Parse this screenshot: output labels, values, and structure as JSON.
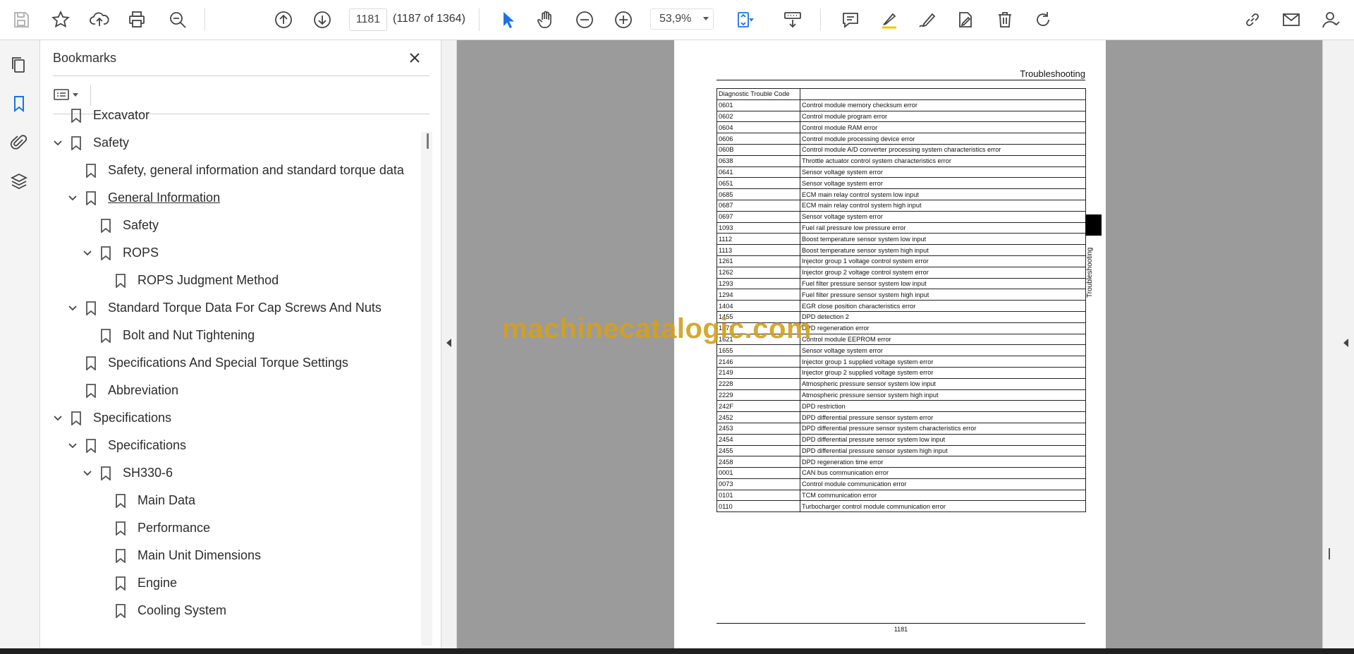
{
  "toolbar": {
    "page_current": "1181",
    "page_count": "(1187 of 1364)",
    "zoom": "53,9%",
    "icons": [
      "save-icon",
      "star-icon",
      "upload-icon",
      "print-icon",
      "zoom-search-icon",
      "prev-page-icon",
      "next-page-icon",
      "select-cursor-icon",
      "hand-icon",
      "zoom-out-icon",
      "zoom-in-icon",
      "fit-page-icon",
      "scroll-mode-icon",
      "comment-icon",
      "highlight-icon",
      "draw-icon",
      "fill-sign-icon",
      "delete-icon",
      "rotate-icon",
      "share-link-icon",
      "mail-icon",
      "account-icon"
    ]
  },
  "panel": {
    "title": "Bookmarks",
    "bookmarks": [
      {
        "label": "Excavator",
        "level": 0,
        "expanded": null,
        "underline": false
      },
      {
        "label": "Safety",
        "level": 0,
        "expanded": true,
        "underline": false
      },
      {
        "label": "Safety, general information and standard torque data",
        "level": 1,
        "expanded": null,
        "underline": false
      },
      {
        "label": "General Information",
        "level": 1,
        "expanded": true,
        "underline": true
      },
      {
        "label": "Safety",
        "level": 2,
        "expanded": null,
        "underline": false
      },
      {
        "label": "ROPS",
        "level": 2,
        "expanded": true,
        "underline": false
      },
      {
        "label": "ROPS Judgment Method",
        "level": 3,
        "expanded": null,
        "underline": false
      },
      {
        "label": "Standard Torque Data For Cap Screws And Nuts",
        "level": 1,
        "expanded": true,
        "underline": false
      },
      {
        "label": "Bolt and Nut Tightening",
        "level": 2,
        "expanded": null,
        "underline": false
      },
      {
        "label": "Specifications And Special Torque Settings",
        "level": 1,
        "expanded": null,
        "underline": false
      },
      {
        "label": "Abbreviation",
        "level": 1,
        "expanded": null,
        "underline": false
      },
      {
        "label": "Specifications",
        "level": 0,
        "expanded": true,
        "underline": false
      },
      {
        "label": "Specifications",
        "level": 1,
        "expanded": true,
        "underline": false
      },
      {
        "label": "SH330-6",
        "level": 2,
        "expanded": true,
        "underline": false
      },
      {
        "label": "Main Data",
        "level": 3,
        "expanded": null,
        "underline": false
      },
      {
        "label": "Performance",
        "level": 3,
        "expanded": null,
        "underline": false
      },
      {
        "label": "Main Unit Dimensions",
        "level": 3,
        "expanded": null,
        "underline": false
      },
      {
        "label": "Engine",
        "level": 3,
        "expanded": null,
        "underline": false
      },
      {
        "label": "Cooling System",
        "level": 3,
        "expanded": null,
        "underline": false
      }
    ]
  },
  "document": {
    "header": "Troubleshooting",
    "side_tab": "Troubleshooting",
    "table_header": [
      "Diagnostic Trouble Code",
      ""
    ],
    "rows": [
      [
        "0601",
        "Control module memory checksum error"
      ],
      [
        "0602",
        "Control module program error"
      ],
      [
        "0604",
        "Control module RAM error"
      ],
      [
        "0606",
        "Control module processing device error"
      ],
      [
        "060B",
        "Control module A/D converter processing system characteristics error"
      ],
      [
        "0638",
        "Throttle actuator control system characteristics error"
      ],
      [
        "0641",
        "Sensor voltage system error"
      ],
      [
        "0651",
        "Sensor voltage system error"
      ],
      [
        "0685",
        "ECM main relay control system low input"
      ],
      [
        "0687",
        "ECM main relay control system high input"
      ],
      [
        "0697",
        "Sensor voltage system error"
      ],
      [
        "1093",
        "Fuel rail pressure low pressure error"
      ],
      [
        "1112",
        "Boost temperature sensor system low input"
      ],
      [
        "1113",
        "Boost temperature sensor system high input"
      ],
      [
        "1261",
        "Injector group 1 voltage control system error"
      ],
      [
        "1262",
        "Injector group 2 voltage control system error"
      ],
      [
        "1293",
        "Fuel filter pressure sensor system low input"
      ],
      [
        "1294",
        "Fuel filter pressure sensor system high input"
      ],
      [
        "1404",
        "EGR close position characteristics error"
      ],
      [
        "1455",
        "DPD detection 2"
      ],
      [
        "1471",
        "DPD regeneration error"
      ],
      [
        "1621",
        "Control module EEPROM error"
      ],
      [
        "1655",
        "Sensor voltage system error"
      ],
      [
        "2146",
        "Injector group 1 supplied voltage system error"
      ],
      [
        "2149",
        "Injector group 2 supplied voltage system error"
      ],
      [
        "2228",
        "Atmospheric pressure sensor system low input"
      ],
      [
        "2229",
        "Atmospheric pressure sensor system high input"
      ],
      [
        "242F",
        "DPD restriction"
      ],
      [
        "2452",
        "DPD differential pressure sensor system error"
      ],
      [
        "2453",
        "DPD differential pressure sensor system characteristics error"
      ],
      [
        "2454",
        "DPD differential pressure sensor system low input"
      ],
      [
        "2455",
        "DPD differential pressure sensor system high input"
      ],
      [
        "2458",
        "DPD regeneration time error"
      ],
      [
        "0001",
        "CAN bus communication error"
      ],
      [
        "0073",
        "Control module communication error"
      ],
      [
        "0101",
        "TCM communication error"
      ],
      [
        "0110",
        "Turbocharger control module communication error"
      ]
    ],
    "page_number": "1181",
    "watermark": "machinecatalogic.com"
  },
  "colors": {
    "accent": "#1a73e8",
    "watermark": "#d4a020",
    "viewer_bg": "#9b9b9b"
  }
}
